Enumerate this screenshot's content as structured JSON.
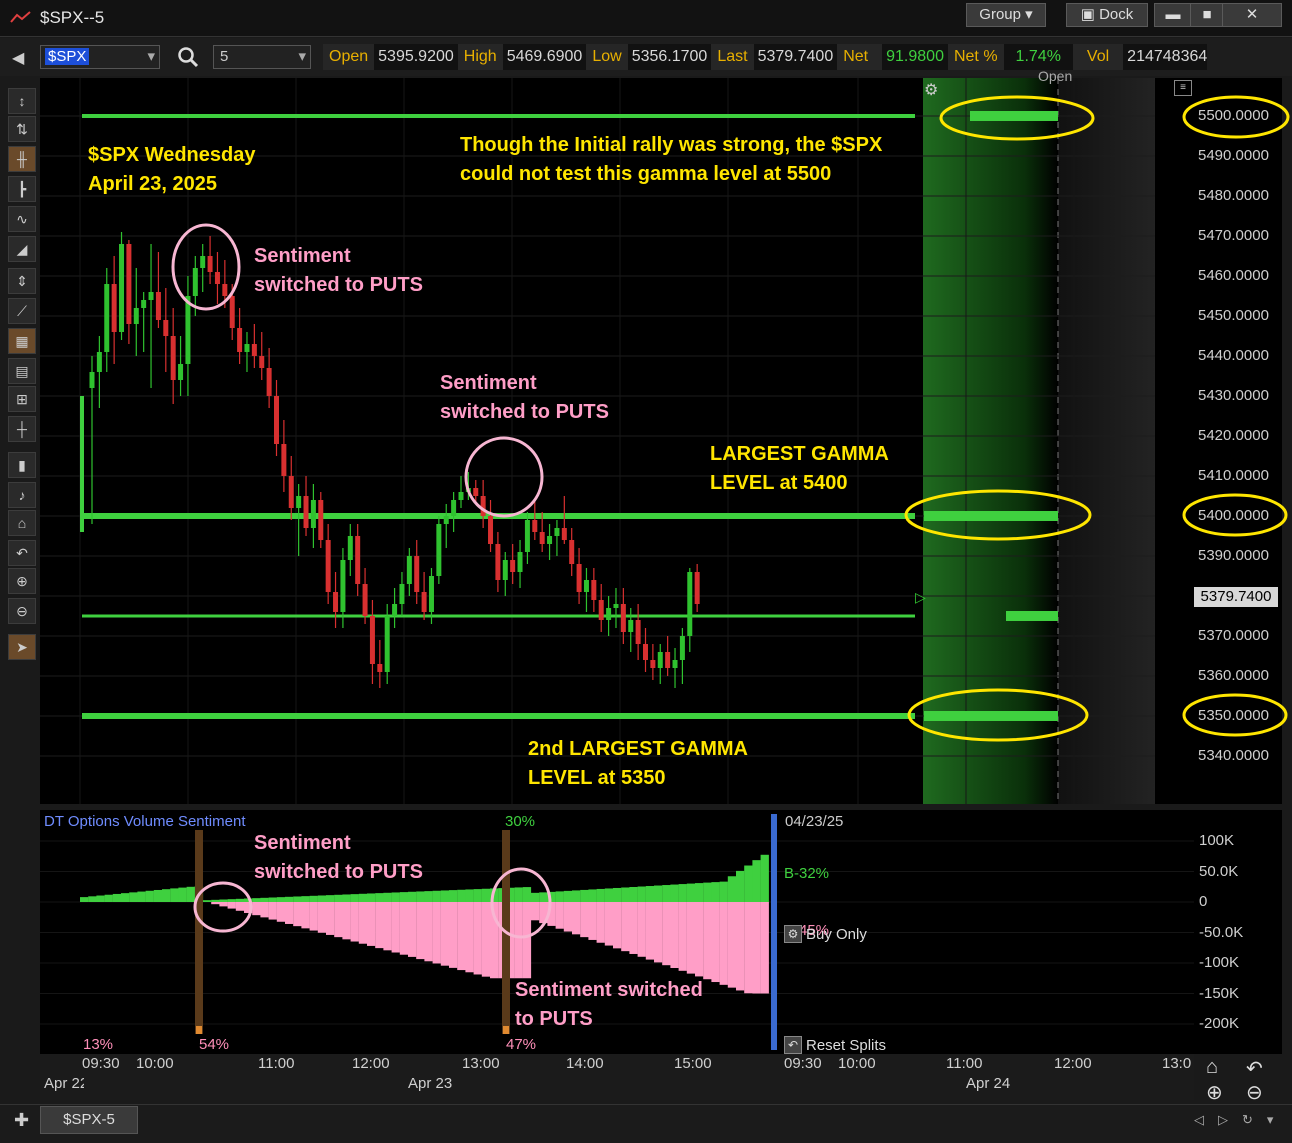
{
  "window": {
    "title": "$SPX--5",
    "group_label": "Group",
    "dock_label": "Dock"
  },
  "toolbar": {
    "symbol": "$SPX",
    "interval": "5",
    "quote": {
      "open_label": "Open",
      "open": "5395.9200",
      "high_label": "High",
      "high": "5469.6900",
      "low_label": "Low",
      "low": "5356.1700",
      "last_label": "Last",
      "last": "5379.7400",
      "net_label": "Net",
      "net": "91.9800",
      "netpct_label": "Net %",
      "netpct": "1.74%",
      "vol_label": "Vol",
      "vol": "214748364"
    }
  },
  "annotations": {
    "title_line1": "$SPX Wednesday",
    "title_line2": "April 23, 2025",
    "rally_line1": "Though the Initial rally was strong, the $SPX",
    "rally_line2": "could not test this gamma level at 5500",
    "sent1_line1": "Sentiment",
    "sent1_line2": "switched to PUTS",
    "sent2_line1": "Sentiment",
    "sent2_line2": "switched to PUTS",
    "gamma1_line1": "LARGEST GAMMA",
    "gamma1_line2": "LEVEL at 5400",
    "gamma2_line1": "2nd LARGEST GAMMA",
    "gamma2_line2": "LEVEL at 5350",
    "sent3_line1": "Sentiment",
    "sent3_line2": "switched to PUTS",
    "sent4_line1": "Sentiment switched",
    "sent4_line2": "to PUTS"
  },
  "price_panel": {
    "open_tag": "Open",
    "last_tag": "5379.7400"
  },
  "indicator": {
    "name": "DT Options Volume Sentiment",
    "date": "04/23/25",
    "buy_label": "B-32%",
    "sell_label": "B-45%",
    "buy_only_label": "Buy Only",
    "reset_label": "Reset Splits",
    "pct_top": "30%",
    "pct_bottom": [
      "13%",
      "54%",
      "47%"
    ],
    "ticks": [
      "100K",
      "50.0K",
      "0",
      "-50.0K",
      "-100K",
      "-150K",
      "-200K"
    ]
  },
  "time_axis": {
    "labels": [
      "09:30",
      "10:00",
      "11:00",
      "12:00",
      "13:00",
      "14:00",
      "15:00",
      "09:30",
      "10:00",
      "11:00",
      "12:00",
      "13:0"
    ],
    "day_labels": [
      "Apr 22",
      "Apr 23",
      "Apr 24"
    ]
  },
  "tab": {
    "label": "$SPX-5"
  },
  "chart_data": {
    "type": "candlestick",
    "symbol": "$SPX",
    "interval": "5",
    "ylim": [
      5330,
      5505
    ],
    "yticks": [
      5340,
      5350,
      5360,
      5370,
      5380,
      5390,
      5400,
      5410,
      5420,
      5430,
      5440,
      5450,
      5460,
      5470,
      5480,
      5490,
      5500
    ],
    "gamma_levels": [
      5500,
      5400,
      5375,
      5350
    ],
    "candles": [
      [
        5432,
        5440,
        5398,
        5436
      ],
      [
        5436,
        5445,
        5427,
        5441
      ],
      [
        5441,
        5462,
        5436,
        5458
      ],
      [
        5458,
        5465,
        5438,
        5446
      ],
      [
        5446,
        5471,
        5444,
        5468
      ],
      [
        5468,
        5469,
        5443,
        5448
      ],
      [
        5448,
        5462,
        5440,
        5452
      ],
      [
        5452,
        5456,
        5441,
        5454
      ],
      [
        5454,
        5468,
        5432,
        5456
      ],
      [
        5456,
        5466,
        5447,
        5449
      ],
      [
        5449,
        5457,
        5436,
        5445
      ],
      [
        5445,
        5452,
        5428,
        5434
      ],
      [
        5434,
        5445,
        5430,
        5438
      ],
      [
        5438,
        5460,
        5430,
        5455
      ],
      [
        5455,
        5465,
        5450,
        5462
      ],
      [
        5462,
        5468,
        5456,
        5465
      ],
      [
        5465,
        5470,
        5458,
        5461
      ],
      [
        5461,
        5466,
        5453,
        5458
      ],
      [
        5458,
        5464,
        5452,
        5455
      ],
      [
        5455,
        5458,
        5444,
        5447
      ],
      [
        5447,
        5452,
        5438,
        5441
      ],
      [
        5441,
        5446,
        5436,
        5443
      ],
      [
        5443,
        5448,
        5437,
        5440
      ],
      [
        5440,
        5446,
        5434,
        5437
      ],
      [
        5437,
        5442,
        5427,
        5430
      ],
      [
        5430,
        5434,
        5415,
        5418
      ],
      [
        5418,
        5424,
        5406,
        5410
      ],
      [
        5410,
        5415,
        5399,
        5402
      ],
      [
        5402,
        5408,
        5390,
        5405
      ],
      [
        5405,
        5410,
        5395,
        5397
      ],
      [
        5397,
        5408,
        5392,
        5404
      ],
      [
        5404,
        5406,
        5392,
        5394
      ],
      [
        5394,
        5398,
        5378,
        5381
      ],
      [
        5381,
        5386,
        5372,
        5376
      ],
      [
        5376,
        5392,
        5372,
        5389
      ],
      [
        5389,
        5398,
        5385,
        5395
      ],
      [
        5395,
        5398,
        5380,
        5383
      ],
      [
        5383,
        5387,
        5373,
        5375
      ],
      [
        5375,
        5379,
        5358,
        5363
      ],
      [
        5363,
        5369,
        5357,
        5361
      ],
      [
        5361,
        5378,
        5358,
        5375
      ],
      [
        5375,
        5382,
        5372,
        5378
      ],
      [
        5378,
        5386,
        5375,
        5383
      ],
      [
        5383,
        5392,
        5380,
        5390
      ],
      [
        5390,
        5394,
        5378,
        5381
      ],
      [
        5381,
        5386,
        5374,
        5376
      ],
      [
        5376,
        5387,
        5373,
        5385
      ],
      [
        5385,
        5400,
        5383,
        5398
      ],
      [
        5398,
        5403,
        5392,
        5400
      ],
      [
        5400,
        5406,
        5396,
        5404
      ],
      [
        5404,
        5410,
        5402,
        5406
      ],
      [
        5406,
        5411,
        5404,
        5407
      ],
      [
        5407,
        5409,
        5403,
        5405
      ],
      [
        5405,
        5409,
        5397,
        5400
      ],
      [
        5400,
        5404,
        5391,
        5393
      ],
      [
        5393,
        5396,
        5381,
        5384
      ],
      [
        5384,
        5391,
        5380,
        5389
      ],
      [
        5389,
        5393,
        5383,
        5386
      ],
      [
        5386,
        5394,
        5382,
        5391
      ],
      [
        5391,
        5401,
        5388,
        5399
      ],
      [
        5399,
        5404,
        5394,
        5396
      ],
      [
        5396,
        5401,
        5391,
        5393
      ],
      [
        5393,
        5398,
        5389,
        5395
      ],
      [
        5395,
        5399,
        5390,
        5397
      ],
      [
        5397,
        5405,
        5393,
        5394
      ],
      [
        5394,
        5397,
        5385,
        5388
      ],
      [
        5388,
        5392,
        5378,
        5381
      ],
      [
        5381,
        5387,
        5376,
        5384
      ],
      [
        5384,
        5387,
        5376,
        5379
      ],
      [
        5379,
        5383,
        5371,
        5374
      ],
      [
        5374,
        5380,
        5370,
        5377
      ],
      [
        5377,
        5382,
        5372,
        5378
      ],
      [
        5378,
        5382,
        5368,
        5371
      ],
      [
        5371,
        5377,
        5366,
        5374
      ],
      [
        5374,
        5378,
        5364,
        5368
      ],
      [
        5368,
        5372,
        5361,
        5364
      ],
      [
        5364,
        5368,
        5359,
        5362
      ],
      [
        5362,
        5368,
        5358,
        5366
      ],
      [
        5366,
        5370,
        5360,
        5362
      ],
      [
        5362,
        5367,
        5357,
        5364
      ],
      [
        5364,
        5372,
        5358,
        5370
      ],
      [
        5370,
        5387,
        5366,
        5386
      ],
      [
        5386,
        5388,
        5376,
        5378
      ]
    ],
    "sentiment_histogram": {
      "unit": "K",
      "buy_peak": 40,
      "sell_trough": -150,
      "switch_markers_time": [
        "10:35",
        "13:15"
      ]
    }
  }
}
